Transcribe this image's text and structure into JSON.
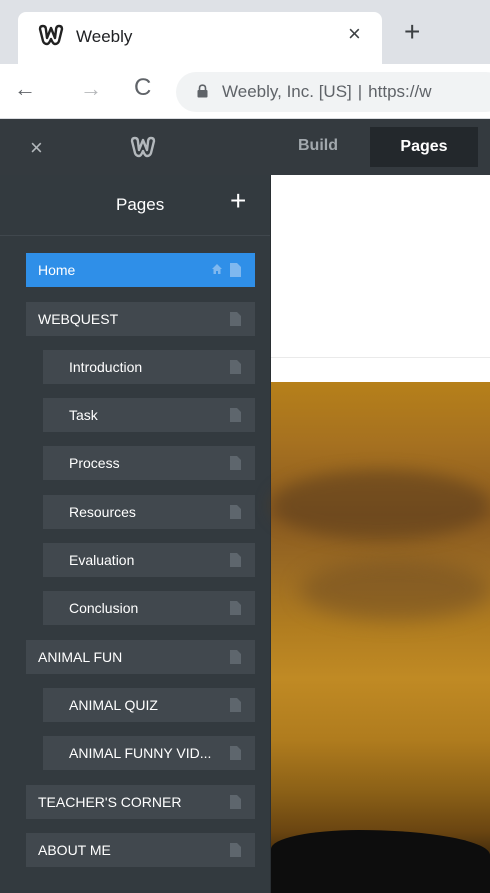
{
  "browser": {
    "tab_title": "Weebly",
    "tab_close": "×",
    "new_tab": "+",
    "back": "←",
    "forward": "→",
    "reload": "C",
    "site_identity": "Weebly, Inc. [US]",
    "separator": "|",
    "url": "https://w"
  },
  "topbar": {
    "close": "×",
    "tabs": [
      {
        "label": "Build"
      },
      {
        "label": "Pages"
      }
    ]
  },
  "sidebar": {
    "title": "Pages",
    "add": "+",
    "pages": [
      {
        "label": "Home",
        "active": true,
        "home": true
      },
      {
        "label": "WEBQUEST"
      },
      {
        "label": "Introduction"
      },
      {
        "label": "Task"
      },
      {
        "label": "Process"
      },
      {
        "label": "Resources"
      },
      {
        "label": "Evaluation"
      },
      {
        "label": "Conclusion"
      },
      {
        "label": "ANIMAL FUN"
      },
      {
        "label": "ANIMAL QUIZ"
      },
      {
        "label": "ANIMAL FUNNY VID..."
      },
      {
        "label": "TEACHER'S CORNER"
      },
      {
        "label": "ABOUT ME"
      }
    ]
  },
  "colors": {
    "active_page": "#2f8fe8",
    "sidebar_bg": "#333a3f",
    "page_item_bg": "#41484e",
    "topbar_bg": "#343a3f"
  }
}
